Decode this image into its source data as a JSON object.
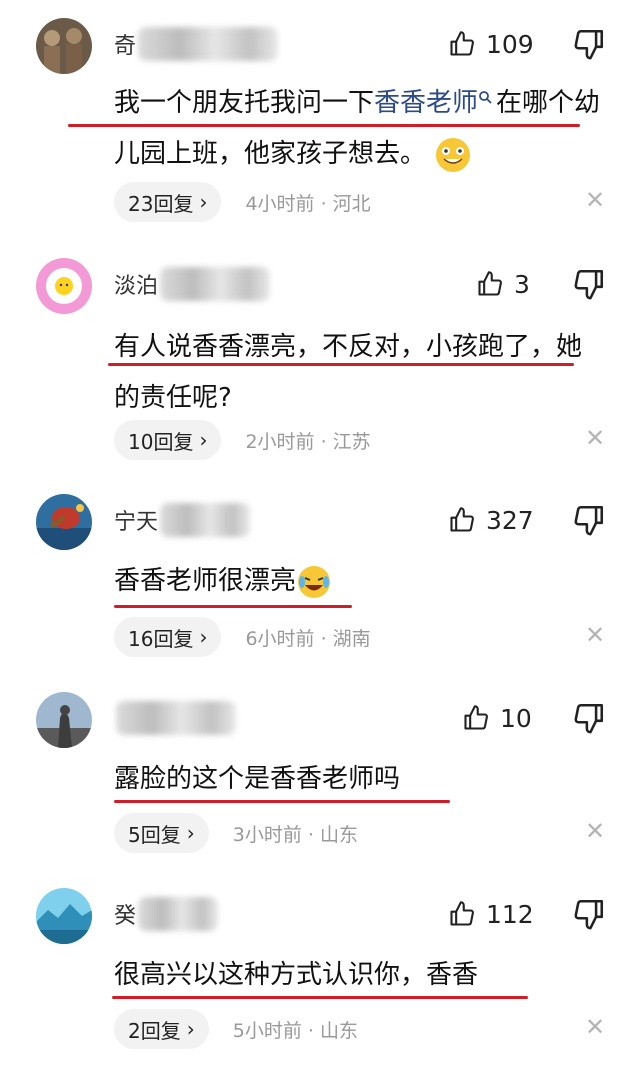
{
  "comments": [
    {
      "name": "奇",
      "likes": "109",
      "text_before": "我一个朋友托我问一下",
      "link": "香香老师",
      "text_after": "在哪个幼儿园上班，他家孩子想去。",
      "replies": "23回复",
      "time": "4小时前 · 河北"
    },
    {
      "name": "淡泊",
      "likes": "3",
      "text": "有人说香香漂亮，不反对，小孩跑了，她的责任呢?",
      "replies": "10回复",
      "time": "2小时前 · 江苏"
    },
    {
      "name": "宁天",
      "likes": "327",
      "text": "香香老师很漂亮",
      "replies": "16回复",
      "time": "6小时前 · 湖南"
    },
    {
      "name": "",
      "likes": "10",
      "text": "露脸的这个是香香老师吗",
      "replies": "5回复",
      "time": "3小时前 · 山东"
    },
    {
      "name": "癸",
      "likes": "112",
      "text": "很高兴以这种方式认识你，香香",
      "replies": "2回复",
      "time": "5小时前 · 山东"
    }
  ],
  "icons": {
    "like": "thumbs-up-icon",
    "dislike": "thumbs-down-icon",
    "close": "close-icon",
    "search": "search-icon"
  },
  "colors": {
    "underline": "#d11e26",
    "link": "#2c4a8a"
  }
}
